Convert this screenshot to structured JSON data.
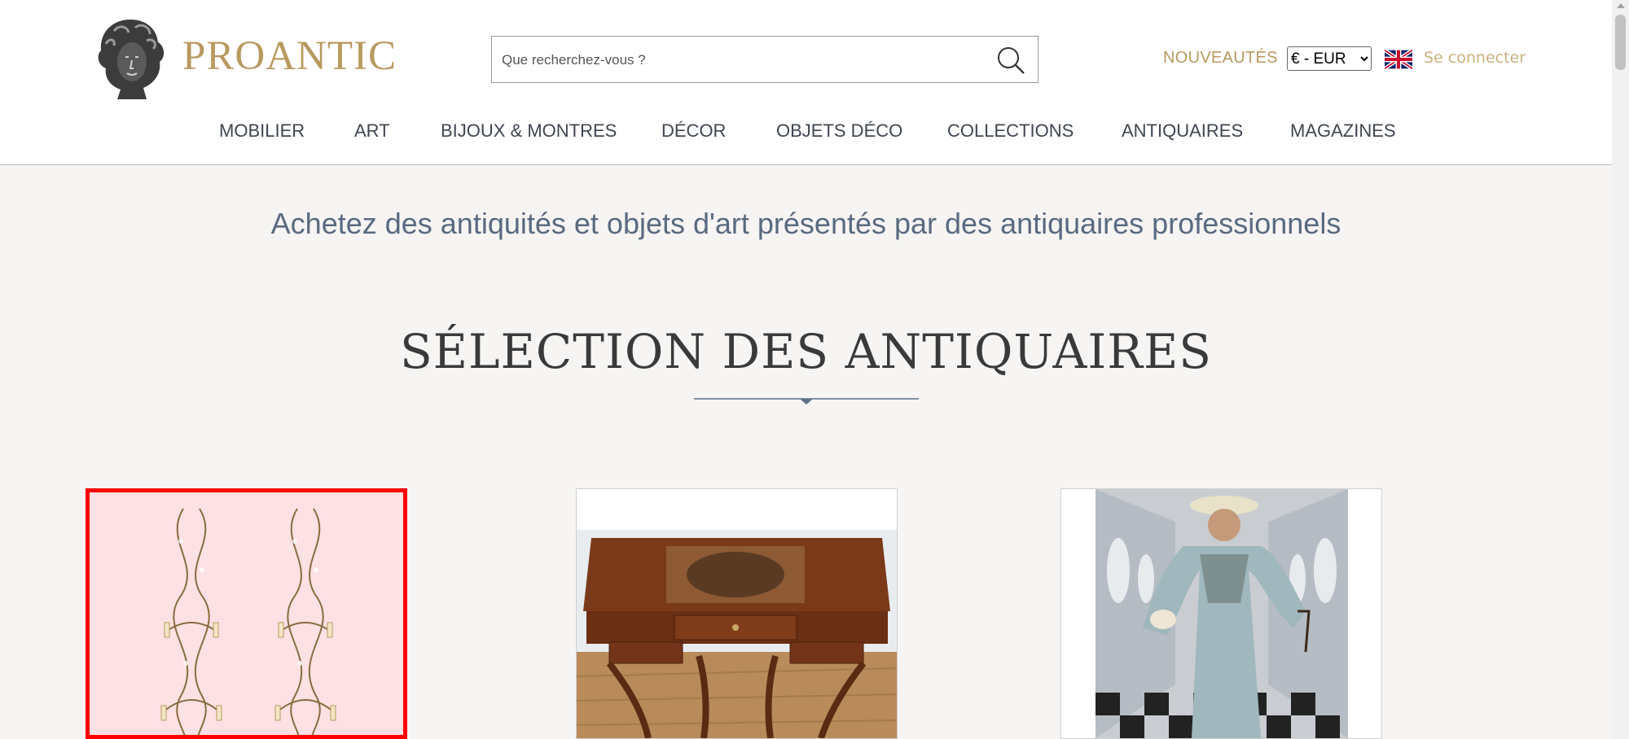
{
  "brand": {
    "name": "PROANTIC"
  },
  "search": {
    "placeholder": "Que recherchez-vous ?"
  },
  "header": {
    "nouveautes": "NOUVEAUTÉS",
    "currency_selected": "€ - EUR",
    "login": "Se connecter"
  },
  "nav": {
    "items": [
      {
        "label": "MOBILIER"
      },
      {
        "label": "ART"
      },
      {
        "label": "BIJOUX & MONTRES"
      },
      {
        "label": "DÉCOR"
      },
      {
        "label": "OBJETS DÉCO"
      },
      {
        "label": "COLLECTIONS"
      },
      {
        "label": "ANTIQUAIRES"
      },
      {
        "label": "MAGAZINES"
      }
    ]
  },
  "main": {
    "tagline": "Achetez des antiquités et objets d'art présentés par des antiquaires professionnels",
    "section_title": "SÉLECTION DES ANTIQUAIRES"
  },
  "colors": {
    "gold": "#b89a5f",
    "nav_text": "#3f4650",
    "tagline": "#596a80",
    "highlight": "#ff0000"
  },
  "icons": {
    "search": "search-icon",
    "flag": "uk-flag-icon",
    "logo": "bust-logo-icon"
  }
}
